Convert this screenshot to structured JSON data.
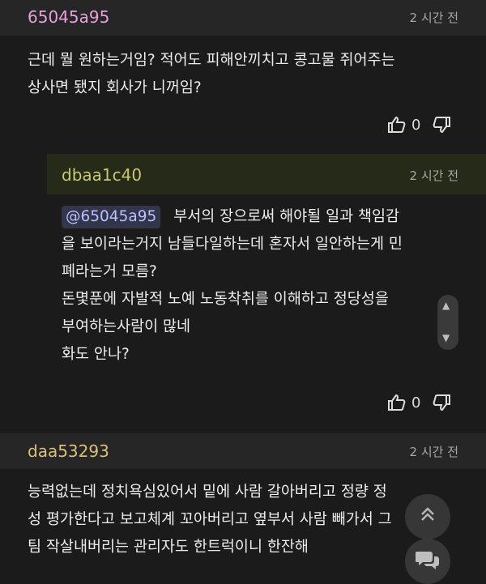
{
  "comments": [
    {
      "author": "65045a95",
      "time": "2 시간 전",
      "lines": [
        "근데 뭘 원하는거임? 적어도 피해안끼치고 콩고물 쥐어주는",
        "상사면 됐지 회사가 니꺼임?"
      ],
      "likes": "0"
    },
    {
      "author": "dbaa1c40",
      "time": "2 시간 전",
      "mention": "@65045a95",
      "lines": [
        "부서의 장으로써 해야될 일과 책임감",
        "을 보이라는거지 남들다일하는데 혼자서 일안하는게 민",
        "폐라는거 모름?",
        "돈몇푼에 자발적 노예 노동착취를 이해하고 정당성을",
        "부여하는사람이 많네",
        "화도 안나?"
      ],
      "likes": "0"
    },
    {
      "author": "daa53293",
      "time": "2 시간 전",
      "lines": [
        "능력없는데 정치욕심있어서 밑에 사람 갈아버리고 정량 정",
        "성 평가한다고 보고체계 꼬아버리고 옆부서 사람 빼가서 그",
        "팀 작살내버리는 관리자도 한트럭이니 한잔해"
      ]
    }
  ],
  "colors": {
    "author1": "#e6a2d8",
    "author2": "#c9c96a",
    "author3": "#d8c07a",
    "reply_header_bg": "#262a18"
  },
  "icons": [
    "thumbs-up-icon",
    "thumbs-down-icon",
    "scroll-up-icon",
    "scroll-down-icon",
    "chevron-up-icon",
    "chat-icon"
  ]
}
